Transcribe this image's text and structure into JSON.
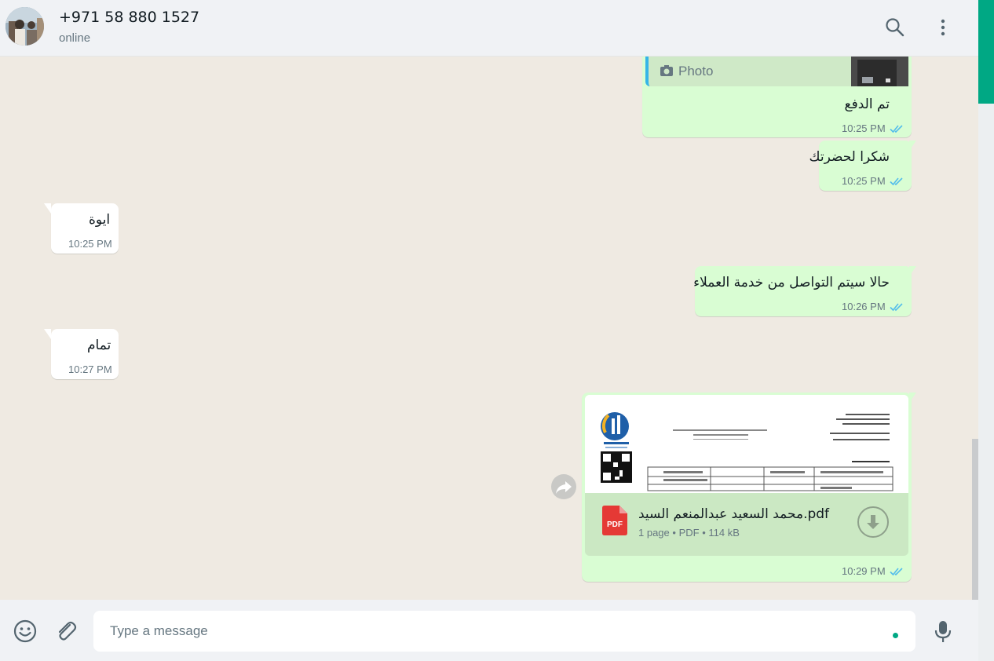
{
  "header": {
    "contact_name": "+971 58 880 1527",
    "status": "online",
    "icons": [
      "search-icon",
      "menu-icon"
    ]
  },
  "messages": [
    {
      "direction": "out",
      "quote_label": "Photo",
      "text": "تم الدفع",
      "time": "10:25 PM",
      "status": "read"
    },
    {
      "direction": "out",
      "text": "شكرا لحضرتك",
      "time": "10:25 PM",
      "status": "read"
    },
    {
      "direction": "in",
      "text": "ايوة",
      "time": "10:25 PM"
    },
    {
      "direction": "out",
      "text": "حالا سيتم التواصل من خدمة العملاء",
      "time": "10:26 PM",
      "status": "read"
    },
    {
      "direction": "in",
      "text": "تمام",
      "time": "10:27 PM"
    },
    {
      "direction": "out",
      "type": "document",
      "file_name": "محمد السعيد عبدالمنعم السيد.pdf",
      "pages": "1 page",
      "file_type": "PDF",
      "size": "114 kB",
      "time": "10:29 PM",
      "status": "read"
    }
  ],
  "footer": {
    "placeholder": "Type a message",
    "icons": [
      "emoji-icon",
      "attach-icon",
      "microphone-icon"
    ]
  },
  "colors": {
    "outgoing_bubble": "#d9fdd3",
    "incoming_bubble": "#ffffff",
    "accent": "#00a884",
    "read_tick": "#53bdeb"
  }
}
